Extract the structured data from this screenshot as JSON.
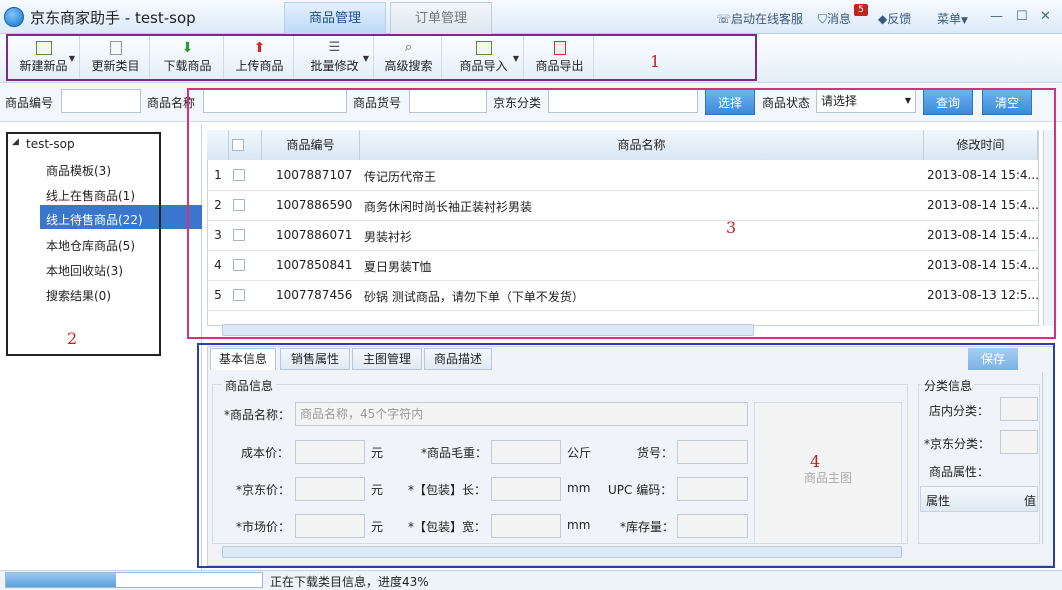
{
  "app": {
    "title": "京东商家助手 - test-sop"
  },
  "main_tabs": [
    {
      "label": "商品管理",
      "active": true
    },
    {
      "label": "订单管理",
      "active": false
    }
  ],
  "title_links": {
    "online_service": "启动在线客服",
    "messages": "消息",
    "message_count": "5",
    "feedback": "反馈",
    "menu": "菜单"
  },
  "toolbar": {
    "items": [
      "新建新品",
      "更新类目",
      "下载商品",
      "上传商品",
      "批量修改",
      "高级搜索",
      "商品导入",
      "商品导出"
    ],
    "annotation": "1"
  },
  "filters": {
    "product_id_label": "商品编号",
    "product_name_label": "商品名称",
    "product_sku_label": "商品货号",
    "jd_category_label": "京东分类",
    "select_button": "选择",
    "status_label": "商品状态",
    "status_value": "请选择",
    "query_button": "查询",
    "clear_button": "清空"
  },
  "tree": {
    "root": "test-sop",
    "items": [
      "商品模板(3)",
      "线上在售商品(1)",
      "线上待售商品(22)",
      "本地仓库商品(5)",
      "本地回收站(3)",
      "搜索结果(0)"
    ],
    "selected_index": 2,
    "annotation": "2"
  },
  "grid": {
    "headers": [
      "商品编号",
      "商品名称",
      "修改时间"
    ],
    "rows": [
      {
        "num": "1",
        "id": "1007887107",
        "name": "传记历代帝王",
        "time": "2013-08-14 15:4..."
      },
      {
        "num": "2",
        "id": "1007886590",
        "name": "商务休闲时尚长袖正装衬衫男装",
        "time": "2013-08-14 15:4..."
      },
      {
        "num": "3",
        "id": "1007886071",
        "name": "男装衬衫",
        "time": "2013-08-14 15:4..."
      },
      {
        "num": "4",
        "id": "1007850841",
        "name": "夏日男装T恤",
        "time": "2013-08-14 15:4..."
      },
      {
        "num": "5",
        "id": "1007787456",
        "name": "砂锅 测试商品，请勿下单（下单不发货）",
        "time": "2013-08-13 12:5..."
      }
    ],
    "annotation": "3"
  },
  "detail": {
    "tabs": [
      "基本信息",
      "销售属性",
      "主图管理",
      "商品描述"
    ],
    "save_button": "保存",
    "section_title": "商品信息",
    "name_label": "*商品名称：",
    "name_placeholder": "商品名称，45个字符内",
    "cost_label": "成本价：",
    "jd_price_label": "*京东价：",
    "market_price_label": "*市场价：",
    "unit_yuan": "元",
    "weight_label": "*商品毛重：",
    "unit_kg": "公斤",
    "length_label": "*【包装】长：",
    "width_label": "*【包装】宽：",
    "unit_mm": "mm",
    "sku_label": "货号：",
    "upc_label": "UPC 编码：",
    "stock_label": "*库存量：",
    "main_image_label": "商品主图",
    "category_section": "分类信息",
    "store_category_label": "店内分类：",
    "jd_category_label": "*京东分类：",
    "attributes_label": "商品属性：",
    "attr_col_name": "属性",
    "attr_col_value": "值",
    "annotation": "4"
  },
  "status": {
    "progress": 0.43,
    "text": "正在下载类目信息，进度43%"
  }
}
